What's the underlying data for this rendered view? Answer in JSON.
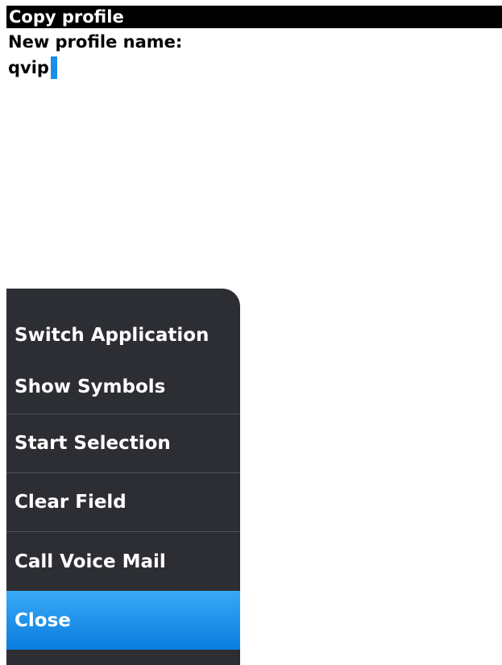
{
  "dialog": {
    "title": "Copy profile",
    "field_label": "New profile name:",
    "field_value": "qvip"
  },
  "menu": {
    "items": [
      {
        "label": "Switch Application"
      },
      {
        "label": "Show Symbols"
      },
      {
        "label": "Start Selection"
      },
      {
        "label": "Clear Field"
      },
      {
        "label": "Call Voice Mail"
      },
      {
        "label": "Close",
        "selected": true
      }
    ]
  },
  "colors": {
    "titlebar_bg": "#000000",
    "menu_bg": "#2c2e33",
    "selection_blue": "#1a8ee8",
    "cursor": "#1a8ee8"
  }
}
